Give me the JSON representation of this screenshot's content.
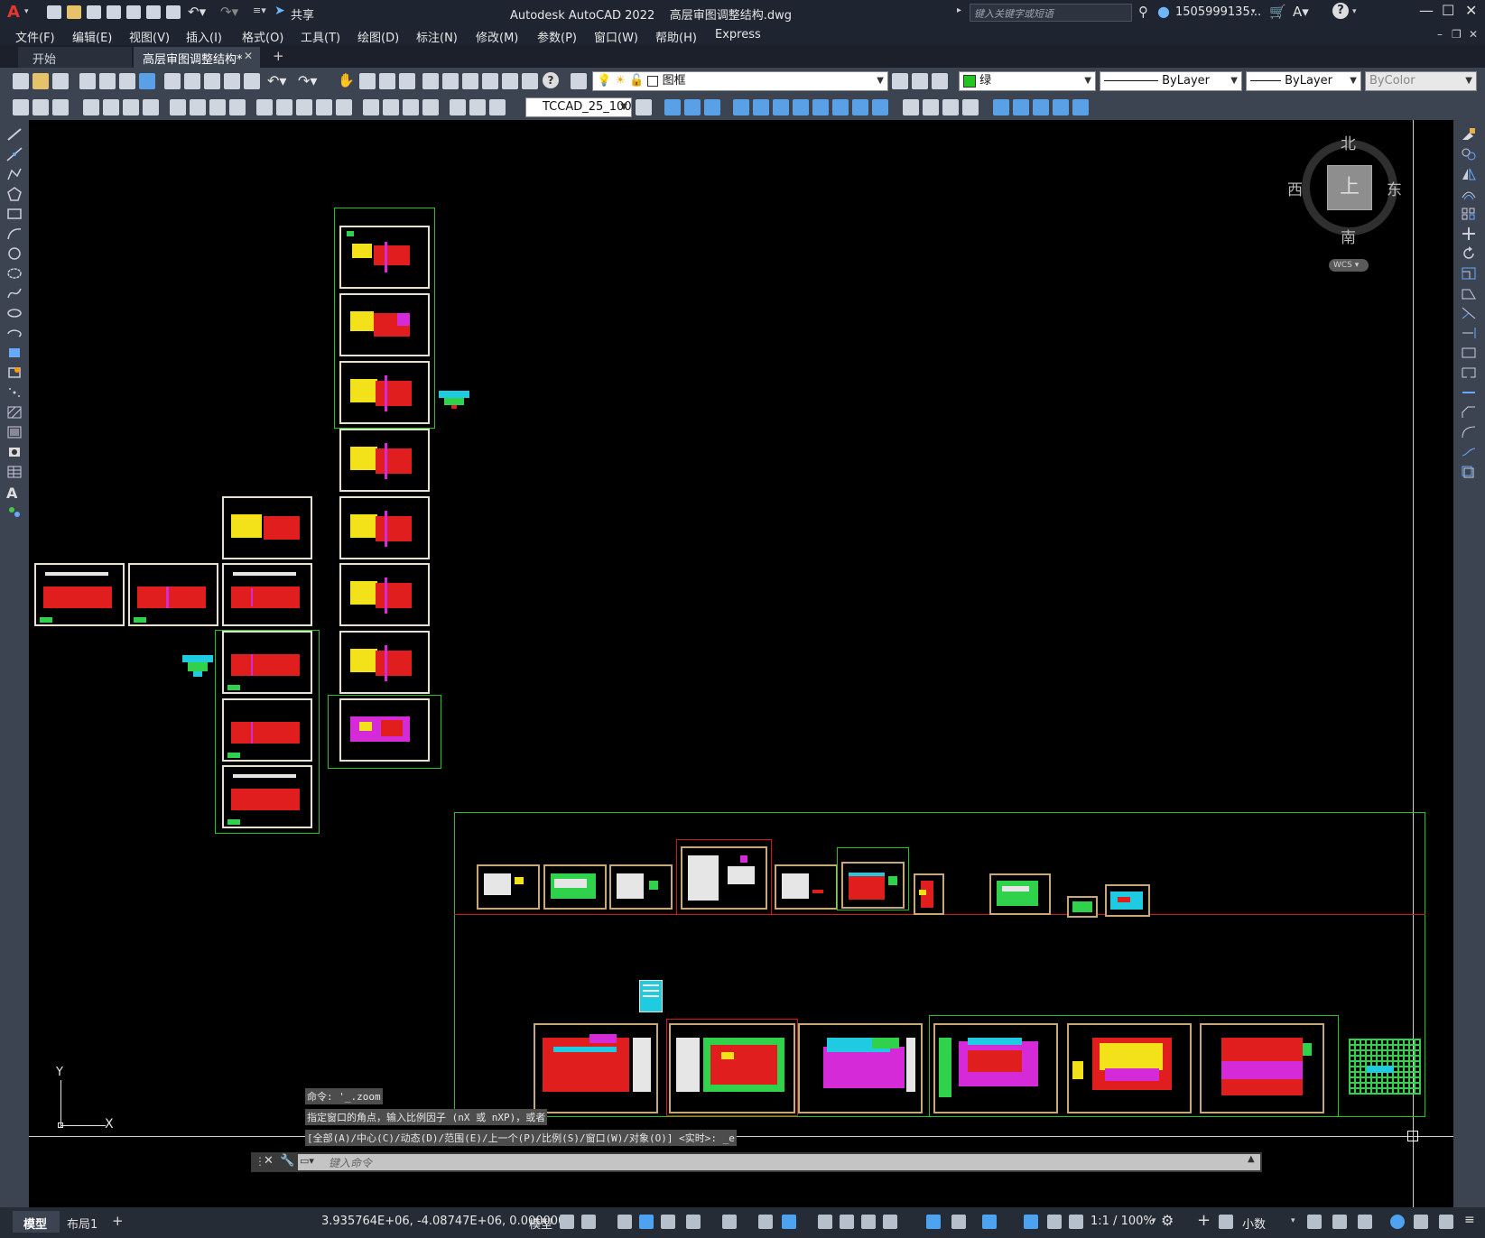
{
  "titlebar": {
    "app_letter": "A",
    "share_label": "共享",
    "title": "Autodesk AutoCAD 2022    高层审图调整结构.dwg",
    "search_placeholder": "键入关键字或短语",
    "user": "1505999135...",
    "help_symbol": "?"
  },
  "menu": [
    "文件(F)",
    "编辑(E)",
    "视图(V)",
    "插入(I)",
    "格式(O)",
    "工具(T)",
    "绘图(D)",
    "标注(N)",
    "修改(M)",
    "参数(P)",
    "窗口(W)",
    "帮助(H)",
    "Express"
  ],
  "tabs": {
    "start": "开始",
    "active": "高层审图调整结构*",
    "close_symbol": "✕",
    "add_symbol": "+"
  },
  "toolbar": {
    "layer_name": "图框",
    "color_name": "绿",
    "linetype": "ByLayer",
    "lineweight": "ByLayer",
    "plotstyle": "ByColor",
    "textstyle": "TCCAD_25_100"
  },
  "colors": {
    "accent": "#22c522",
    "red": "#e01e1e",
    "yellow": "#f3e21a",
    "magenta": "#d42ad8",
    "cyan": "#1ecbe0"
  },
  "viewcube": {
    "north": "北",
    "south": "南",
    "east": "东",
    "west": "西",
    "top": "上",
    "wcs": "WCS"
  },
  "ucs": {
    "y": "Y",
    "x": "X"
  },
  "command": {
    "history": [
      "命令: '_.zoom",
      "指定窗口的角点，输入比例因子 (nX 或 nXP)，或者",
      "[全部(A)/中心(C)/动态(D)/范围(E)/上一个(P)/比例(S)/窗口(W)/对象(O)] <实时>: _e"
    ],
    "placeholder": "键入命令"
  },
  "status": {
    "tab_model": "模型",
    "tab_layout": "布局1",
    "add": "+",
    "coords": "3.935764E+06, -4.08747E+06, 0.000000",
    "space": "模型",
    "scale": "1:1 / 100%",
    "units": "小数"
  }
}
